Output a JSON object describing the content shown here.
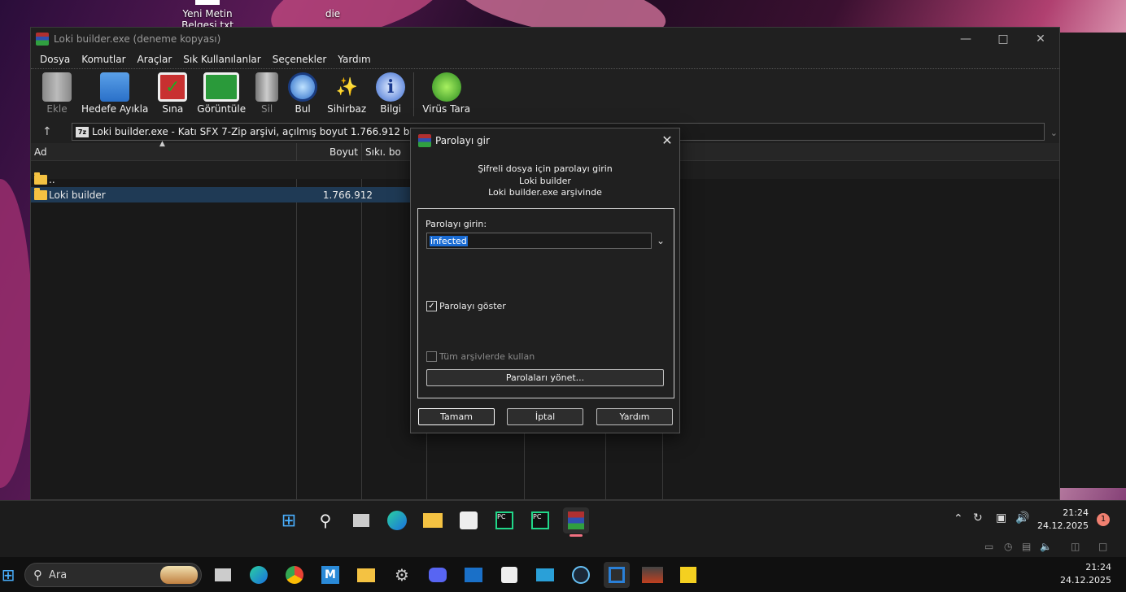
{
  "desktop": {
    "icons": [
      {
        "label": "Yeni Metin Belgesi.txt"
      },
      {
        "label": "die"
      }
    ]
  },
  "window": {
    "title": "Loki builder.exe (deneme kopyası)",
    "menu": [
      "Dosya",
      "Komutlar",
      "Araçlar",
      "Sık Kullanılanlar",
      "Seçenekler",
      "Yardım"
    ],
    "toolbar": [
      {
        "label": "Ekle",
        "icon": "add-archive-icon",
        "disabled": true
      },
      {
        "label": "Hedefe Ayıkla",
        "icon": "extract-folder-icon"
      },
      {
        "label": "Sına",
        "icon": "test-clipboard-icon"
      },
      {
        "label": "Görüntüle",
        "icon": "view-book-icon"
      },
      {
        "label": "Sil",
        "icon": "trash-icon",
        "disabled": true
      },
      {
        "label": "Bul",
        "icon": "find-magnifier-icon"
      },
      {
        "label": "Sihirbaz",
        "icon": "wizard-wand-icon"
      },
      {
        "label": "Bilgi",
        "icon": "info-icon"
      },
      {
        "label": "Virüs Tara",
        "icon": "virus-scan-icon"
      }
    ],
    "address": "Loki builder.exe - Katı SFX 7-Zip arşivi, açılmış boyut 1.766.912 bayt",
    "columns": [
      "Ad",
      "Boyut",
      "Sıkı. bo"
    ],
    "rows": [
      {
        "name": "..",
        "size": ""
      },
      {
        "name": "Loki builder",
        "size": "1.766.912"
      }
    ]
  },
  "dialog": {
    "title": "Parolayı gir",
    "info": [
      "Şifreli dosya için parolayı girin",
      "Loki builder",
      "Loki builder.exe arşivinde"
    ],
    "password_label": "Parolayı girin:",
    "password_value": "infected",
    "show_password_label": "Parolayı göster",
    "show_password_checked": true,
    "use_all_label": "Tüm arşivlerde kullan",
    "manage_label": "Parolaları yönet...",
    "ok_label": "Tamam",
    "cancel_label": "İptal",
    "help_label": "Yardım"
  },
  "taskbar_top": {
    "time": "21:24",
    "date": "24.12.2025",
    "notification_count": "1"
  },
  "taskbar_bottom": {
    "search_label": "Ara",
    "time": "21:24",
    "date": "24.12.2025"
  }
}
